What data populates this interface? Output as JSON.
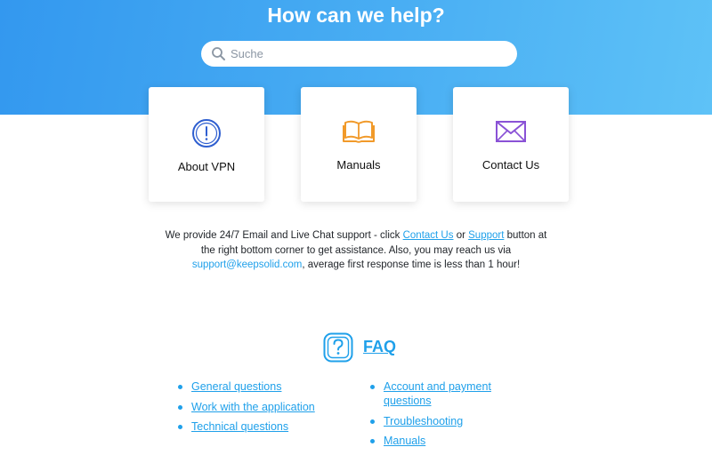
{
  "hero": {
    "title": "How can we help?",
    "search_placeholder": "Suche",
    "search_value": "",
    "search_icon": "search-icon"
  },
  "cards": [
    {
      "label": "About VPN",
      "icon": "info-circle-icon",
      "color": "#2f5fd0"
    },
    {
      "label": "Manuals",
      "icon": "book-icon",
      "color": "#f19a2a"
    },
    {
      "label": "Contact Us",
      "icon": "envelope-icon",
      "color": "#8a52d6"
    }
  ],
  "support": {
    "text_1": "We provide 24/7 Email and Live Chat support - click ",
    "contact_link": "Contact Us",
    "text_2": " or ",
    "support_link": "Support",
    "text_3": " button at the right bottom corner to get assistance. Also, you may reach us via ",
    "email_link": "support@keepsolid.com",
    "text_4": ", average first response time is less than 1 hour!"
  },
  "faq": {
    "title": "FAQ",
    "icon": "question-icon",
    "left_items": [
      "General questions",
      "Work with the application",
      "Technical questions"
    ],
    "right_items": [
      "Account and payment questions",
      "Troubleshooting",
      "Manuals"
    ]
  },
  "colors": {
    "hero_start": "#3398ef",
    "hero_end": "#5ec2f7",
    "link": "#1fa0ea"
  }
}
